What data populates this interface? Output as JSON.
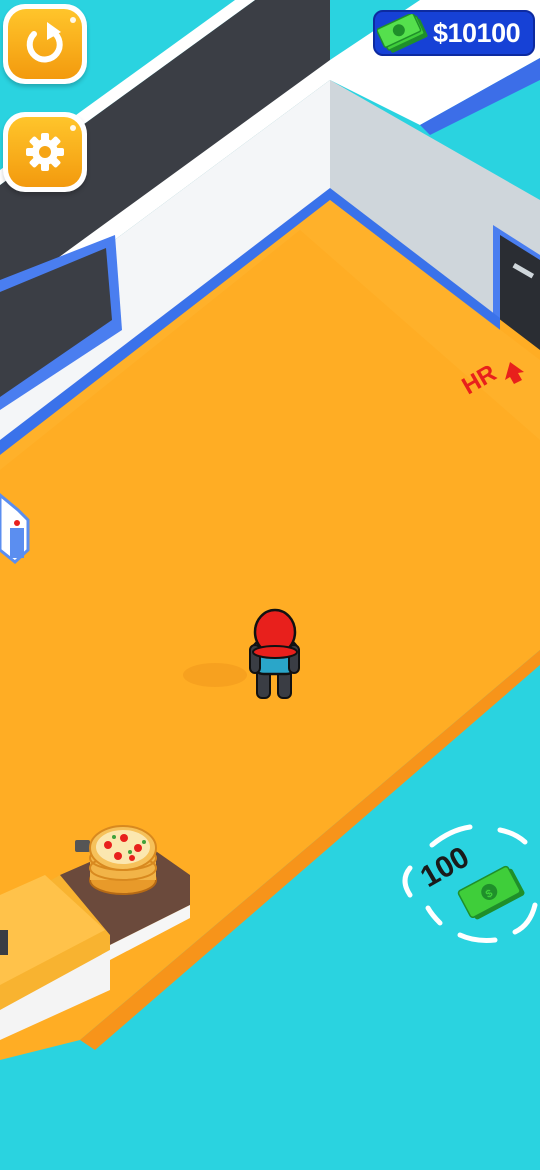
{
  "hud": {
    "money": "$10100",
    "money_icon": "cash-stack-icon",
    "restart_icon": "restart-icon",
    "settings_icon": "gear-icon"
  },
  "world": {
    "hr_sign": "HR",
    "unlock_price": "100",
    "unlock_icon": "cash-bill-icon"
  },
  "colors": {
    "floor": "#ffad24",
    "outside": "#2ad3e0",
    "wall_dark": "#3b3e45",
    "money_bg": "#1641d6",
    "button": "#f7a81a",
    "hr_sign": "#e8201c"
  }
}
